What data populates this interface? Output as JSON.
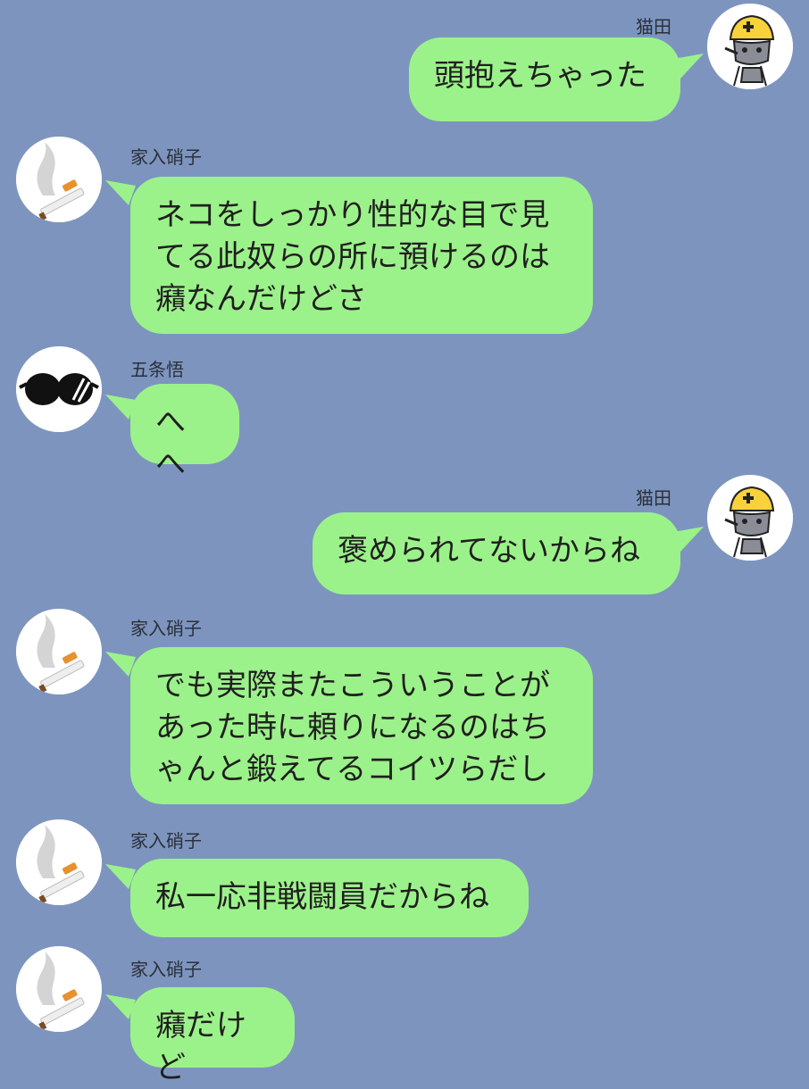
{
  "messages": [
    {
      "sender": "猫田",
      "avatar": "cat-helmet-avatar",
      "side": "right",
      "text": "頭抱えちゃった"
    },
    {
      "sender": "家入硝子",
      "avatar": "cigarette-avatar",
      "side": "left",
      "text": "ネコをしっかり性的な目で見\nてる此奴らの所に預けるのは\n癪なんだけどさ"
    },
    {
      "sender": "五条悟",
      "avatar": "sunglasses-avatar",
      "side": "left",
      "text": "へへ"
    },
    {
      "sender": "猫田",
      "avatar": "cat-helmet-avatar",
      "side": "right",
      "text": "褒められてないからね"
    },
    {
      "sender": "家入硝子",
      "avatar": "cigarette-avatar",
      "side": "left",
      "text": "でも実際またこういうことが\nあった時に頼りになるのはち\nゃんと鍛えてるコイツらだし"
    },
    {
      "sender": "家入硝子",
      "avatar": "cigarette-avatar",
      "side": "left",
      "text": "私一応非戦闘員だからね"
    },
    {
      "sender": "家入硝子",
      "avatar": "cigarette-avatar",
      "side": "left",
      "text": "癪だけど"
    }
  ],
  "colors": {
    "background": "#7d95be",
    "bubble": "#9cf28a",
    "text": "#1f1f1f"
  }
}
